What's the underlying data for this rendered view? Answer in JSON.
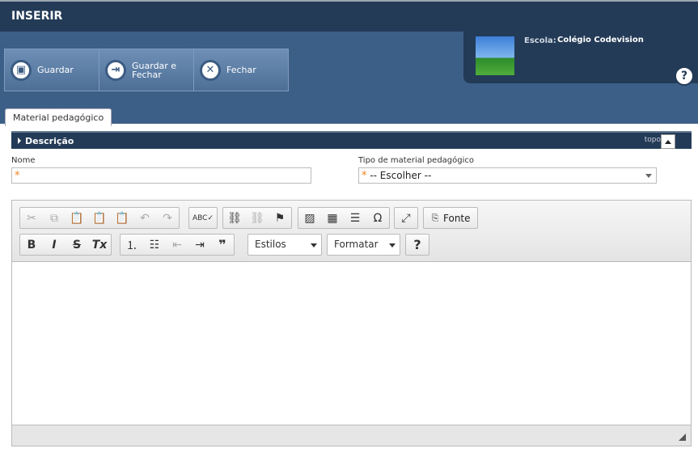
{
  "window": {
    "title": "INSERIR"
  },
  "toolbar": {
    "save": "Guardar",
    "save_close": "Guardar e Fechar",
    "close": "Fechar"
  },
  "school": {
    "label": "Escola:",
    "name": "Colégio Codevision"
  },
  "help": "?",
  "tabs": [
    {
      "label": "Material pedagógico"
    }
  ],
  "section": {
    "title": "Descrição",
    "top_link": "topo"
  },
  "form": {
    "name": {
      "label": "Nome",
      "required": "*",
      "value": ""
    },
    "type": {
      "label": "Tipo de material pedagógico",
      "required": "*",
      "selected": "-- Escolher --"
    }
  },
  "editor": {
    "source_label": "Fonte",
    "styles_label": "Estilos",
    "format_label": "Formatar",
    "help": "?",
    "icons": [
      "cut-icon",
      "copy-icon",
      "paste-icon",
      "paste-text-icon",
      "paste-word-icon",
      "undo-icon",
      "redo-icon",
      "spellcheck-icon",
      "link-icon",
      "unlink-icon",
      "anchor-icon",
      "image-icon",
      "table-icon",
      "horizontal-line-icon",
      "special-char-icon",
      "maximize-icon",
      "source-icon",
      "bold-icon",
      "italic-icon",
      "strike-icon",
      "remove-format-icon",
      "numbered-list-icon",
      "bulleted-list-icon",
      "outdent-icon",
      "indent-icon",
      "blockquote-icon",
      "help-icon"
    ]
  },
  "colors": {
    "header": "#233b57",
    "band": "#3c5f88",
    "accent": "#f0821e"
  }
}
